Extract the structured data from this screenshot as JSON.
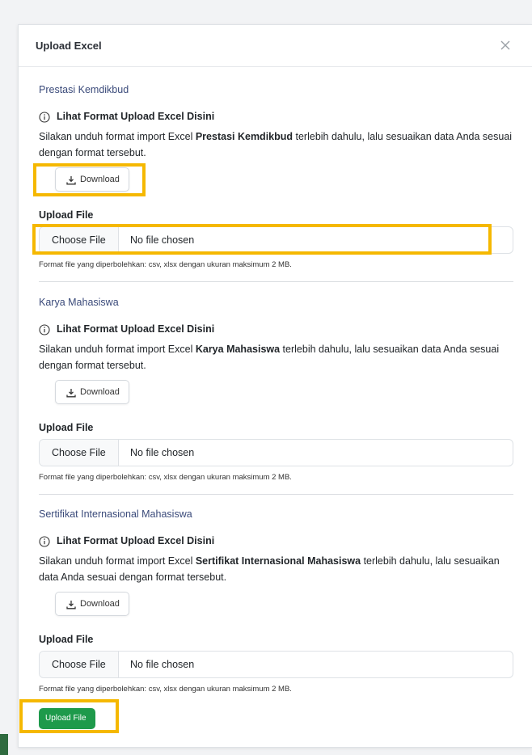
{
  "modal": {
    "title": "Upload Excel",
    "close_icon": "close-icon"
  },
  "sections": [
    {
      "title": "Prestasi Kemdikbud",
      "info_label": "Lihat Format Upload Excel Disini",
      "desc_before": "Silakan unduh format import Excel ",
      "desc_bold": "Prestasi Kemdikbud",
      "desc_after": " terlebih dahulu, lalu sesuaikan data Anda sesuai dengan format tersebut.",
      "download_label": "Download",
      "upload_label": "Upload File",
      "choose_label": "Choose File",
      "file_status": "No file chosen",
      "hint": "Format file yang diperbolehkan: csv, xlsx dengan ukuran maksimum 2 MB."
    },
    {
      "title": "Karya Mahasiswa",
      "info_label": "Lihat Format Upload Excel Disini",
      "desc_before": "Silakan unduh format import Excel ",
      "desc_bold": "Karya Mahasiswa",
      "desc_after": " terlebih dahulu, lalu sesuaikan data Anda sesuai dengan format tersebut.",
      "download_label": "Download",
      "upload_label": "Upload File",
      "choose_label": "Choose File",
      "file_status": "No file chosen",
      "hint": "Format file yang diperbolehkan: csv, xlsx dengan ukuran maksimum 2 MB."
    },
    {
      "title": "Sertifikat Internasional Mahasiswa",
      "info_label": "Lihat Format Upload Excel Disini",
      "desc_before": "Silakan unduh format import Excel ",
      "desc_bold": "Sertifikat Internasional Mahasiswa",
      "desc_after": " terlebih dahulu, lalu sesuaikan data Anda sesuai dengan format tersebut.",
      "download_label": "Download",
      "upload_label": "Upload File",
      "choose_label": "Choose File",
      "file_status": "No file chosen",
      "hint": "Format file yang diperbolehkan: csv, xlsx dengan ukuran maksimum 2 MB."
    }
  ],
  "footer": {
    "upload_button_label": "Upload File"
  },
  "colors": {
    "accent_green": "#1e9a4b",
    "highlight": "#f5b800",
    "section_title": "#3a4a7a"
  },
  "icons": {
    "info": "info-circle-icon",
    "download": "download-icon"
  }
}
